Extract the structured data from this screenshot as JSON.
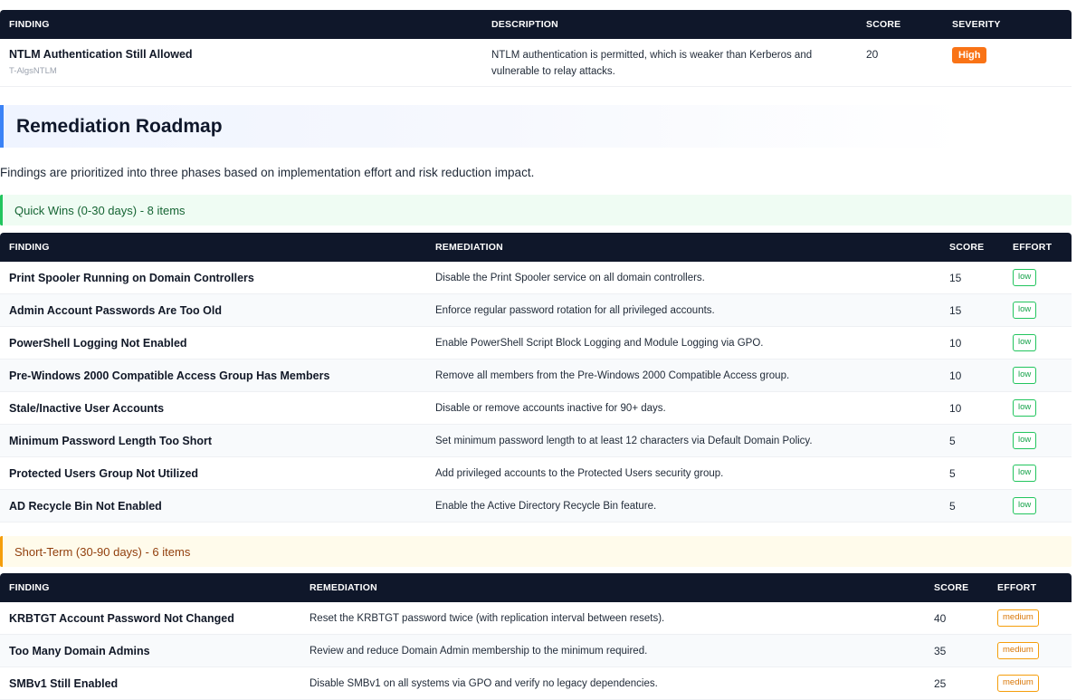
{
  "top_table": {
    "headers": [
      "FINDING",
      "DESCRIPTION",
      "SCORE",
      "SEVERITY"
    ],
    "rows": [
      {
        "finding": "NTLM Authentication Still Allowed",
        "id": "T-AlgsNTLM",
        "description": "NTLM authentication is permitted, which is weaker than Kerberos and vulnerable to relay attacks.",
        "score": "20",
        "severity": "High"
      }
    ]
  },
  "roadmap": {
    "title": "Remediation Roadmap",
    "intro": "Findings are prioritized into three phases based on implementation effort and risk reduction impact."
  },
  "phases": {
    "quick": {
      "label": "Quick Wins (0-30 days) - 8 items",
      "headers": [
        "FINDING",
        "REMEDIATION",
        "SCORE",
        "EFFORT"
      ],
      "rows": [
        {
          "finding": "Print Spooler Running on Domain Controllers",
          "remediation": "Disable the Print Spooler service on all domain controllers.",
          "score": "15",
          "effort": "low"
        },
        {
          "finding": "Admin Account Passwords Are Too Old",
          "remediation": "Enforce regular password rotation for all privileged accounts.",
          "score": "15",
          "effort": "low"
        },
        {
          "finding": "PowerShell Logging Not Enabled",
          "remediation": "Enable PowerShell Script Block Logging and Module Logging via GPO.",
          "score": "10",
          "effort": "low"
        },
        {
          "finding": "Pre-Windows 2000 Compatible Access Group Has Members",
          "remediation": "Remove all members from the Pre-Windows 2000 Compatible Access group.",
          "score": "10",
          "effort": "low"
        },
        {
          "finding": "Stale/Inactive User Accounts",
          "remediation": "Disable or remove accounts inactive for 90+ days.",
          "score": "10",
          "effort": "low"
        },
        {
          "finding": "Minimum Password Length Too Short",
          "remediation": "Set minimum password length to at least 12 characters via Default Domain Policy.",
          "score": "5",
          "effort": "low"
        },
        {
          "finding": "Protected Users Group Not Utilized",
          "remediation": "Add privileged accounts to the Protected Users security group.",
          "score": "5",
          "effort": "low"
        },
        {
          "finding": "AD Recycle Bin Not Enabled",
          "remediation": "Enable the Active Directory Recycle Bin feature.",
          "score": "5",
          "effort": "low"
        }
      ]
    },
    "short": {
      "label": "Short-Term (30-90 days) - 6 items",
      "headers": [
        "FINDING",
        "REMEDIATION",
        "SCORE",
        "EFFORT"
      ],
      "rows": [
        {
          "finding": "KRBTGT Account Password Not Changed",
          "remediation": "Reset the KRBTGT password twice (with replication interval between resets).",
          "score": "40",
          "effort": "medium"
        },
        {
          "finding": "Too Many Domain Admins",
          "remediation": "Review and reduce Domain Admin membership to the minimum required.",
          "score": "35",
          "effort": "medium"
        },
        {
          "finding": "SMBv1 Still Enabled",
          "remediation": "Disable SMBv1 on all systems via GPO and verify no legacy dependencies.",
          "score": "25",
          "effort": "medium"
        }
      ]
    }
  },
  "colors": {
    "header_bg": "#0f172a",
    "severity_high": "#f97316",
    "phase_quick": "#22c55e",
    "phase_short": "#f59e0b",
    "roadmap_accent": "#3b82f6"
  }
}
